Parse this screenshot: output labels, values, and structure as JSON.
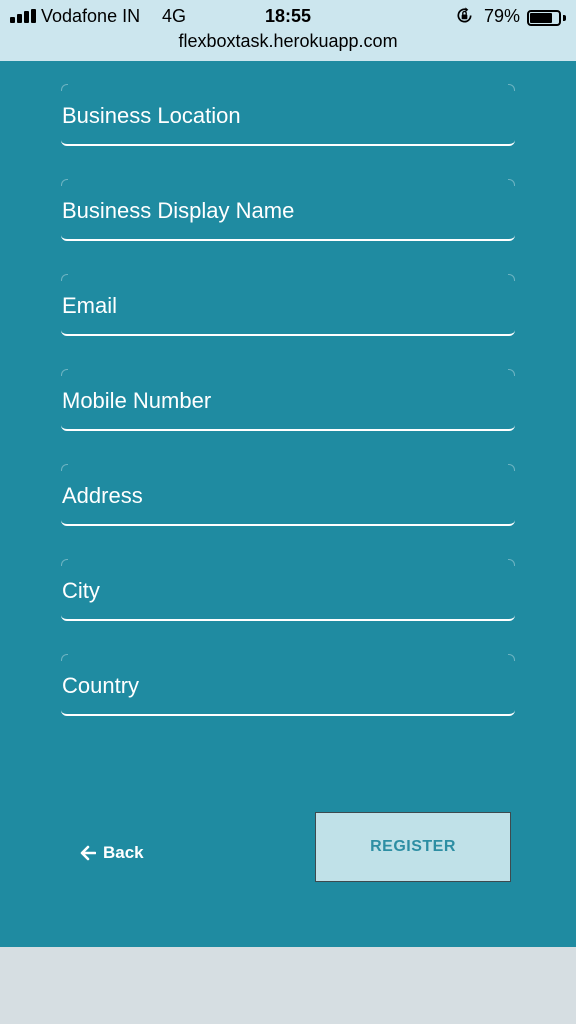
{
  "status_bar": {
    "carrier": "Vodafone IN",
    "network": "4G",
    "time": "18:55",
    "battery_percent": "79%",
    "battery_level": 0.79,
    "url": "flexboxtask.herokuapp.com"
  },
  "form": {
    "fields": [
      {
        "placeholder": "Business Location",
        "value": ""
      },
      {
        "placeholder": "Business Display Name",
        "value": ""
      },
      {
        "placeholder": "Email",
        "value": ""
      },
      {
        "placeholder": "Mobile Number",
        "value": ""
      },
      {
        "placeholder": "Address",
        "value": ""
      },
      {
        "placeholder": "City",
        "value": ""
      },
      {
        "placeholder": "Country",
        "value": ""
      }
    ],
    "back_label": "Back",
    "register_label": "REGISTER"
  },
  "colors": {
    "panel": "#1f8ba1",
    "status_bar": "#cce6ee",
    "register_bg": "#c0e1e8",
    "register_text": "#2d8ea3",
    "page_bg": "#d6dee2"
  },
  "icons": {
    "signal": "signal-bars-icon",
    "orientation_lock": "orientation-lock-icon",
    "battery": "battery-icon",
    "back_arrow": "arrow-left-icon"
  }
}
